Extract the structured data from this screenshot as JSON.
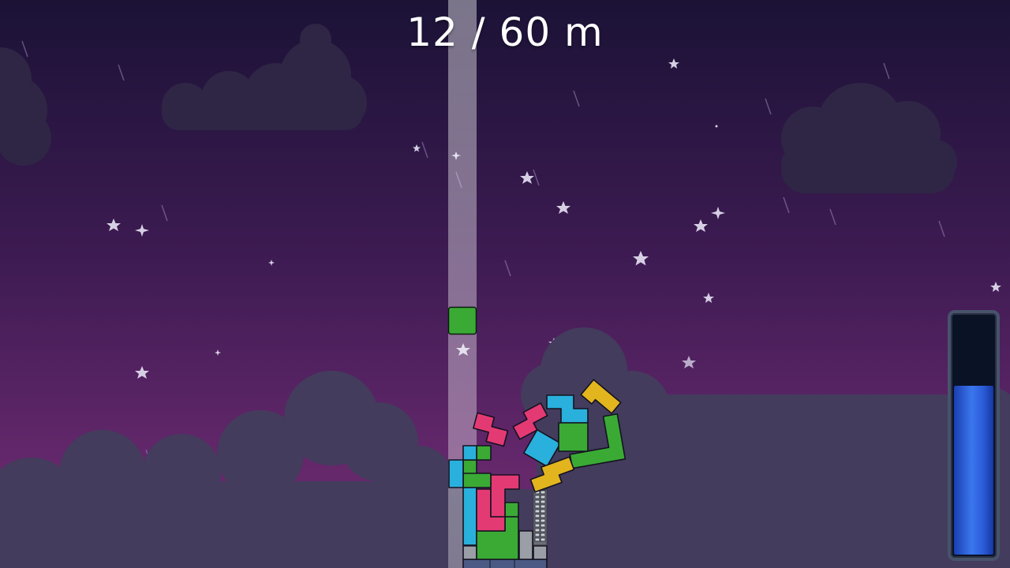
{
  "hud": {
    "height_text": "12 / 60 m",
    "current_height_m": 12,
    "goal_height_m": 60
  },
  "power_meter": {
    "fill_fraction": 0.71,
    "color": "#2a5bd6"
  },
  "next_piece": {
    "shape": "O-small",
    "color": "#3aaa35"
  },
  "colors": {
    "sky_top": "#1a1135",
    "sky_bottom": "#6e2a70",
    "cloud_far": "#2e2545",
    "cloud_near": "#443e5c",
    "beam": "#ffffff",
    "piece_green": "#3aaa35",
    "piece_pink": "#e43a74",
    "piece_cyan": "#2ab0dc",
    "piece_yellow": "#e2b51e",
    "stone": "#c8ccd4"
  }
}
